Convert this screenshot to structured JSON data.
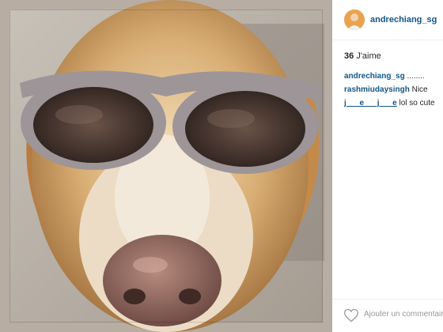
{
  "post": {
    "username": "andrechiang_sg",
    "likes_count": "36",
    "likes_word": "J'aime",
    "caption": {
      "author": "andrechiang_sg",
      "text": "........"
    },
    "comments": [
      {
        "author": "rashmiudaysingh",
        "text": "Nice"
      },
      {
        "author": "j___e___j___e",
        "text": "lol so cute"
      }
    ],
    "add_comment_placeholder": "Ajouter un commentaire",
    "icons": {
      "like": "heart-icon",
      "avatar": "profile-avatar"
    }
  },
  "colors": {
    "username_blue": "#125688",
    "text_dark": "#262626",
    "placeholder_gray": "#999999"
  }
}
